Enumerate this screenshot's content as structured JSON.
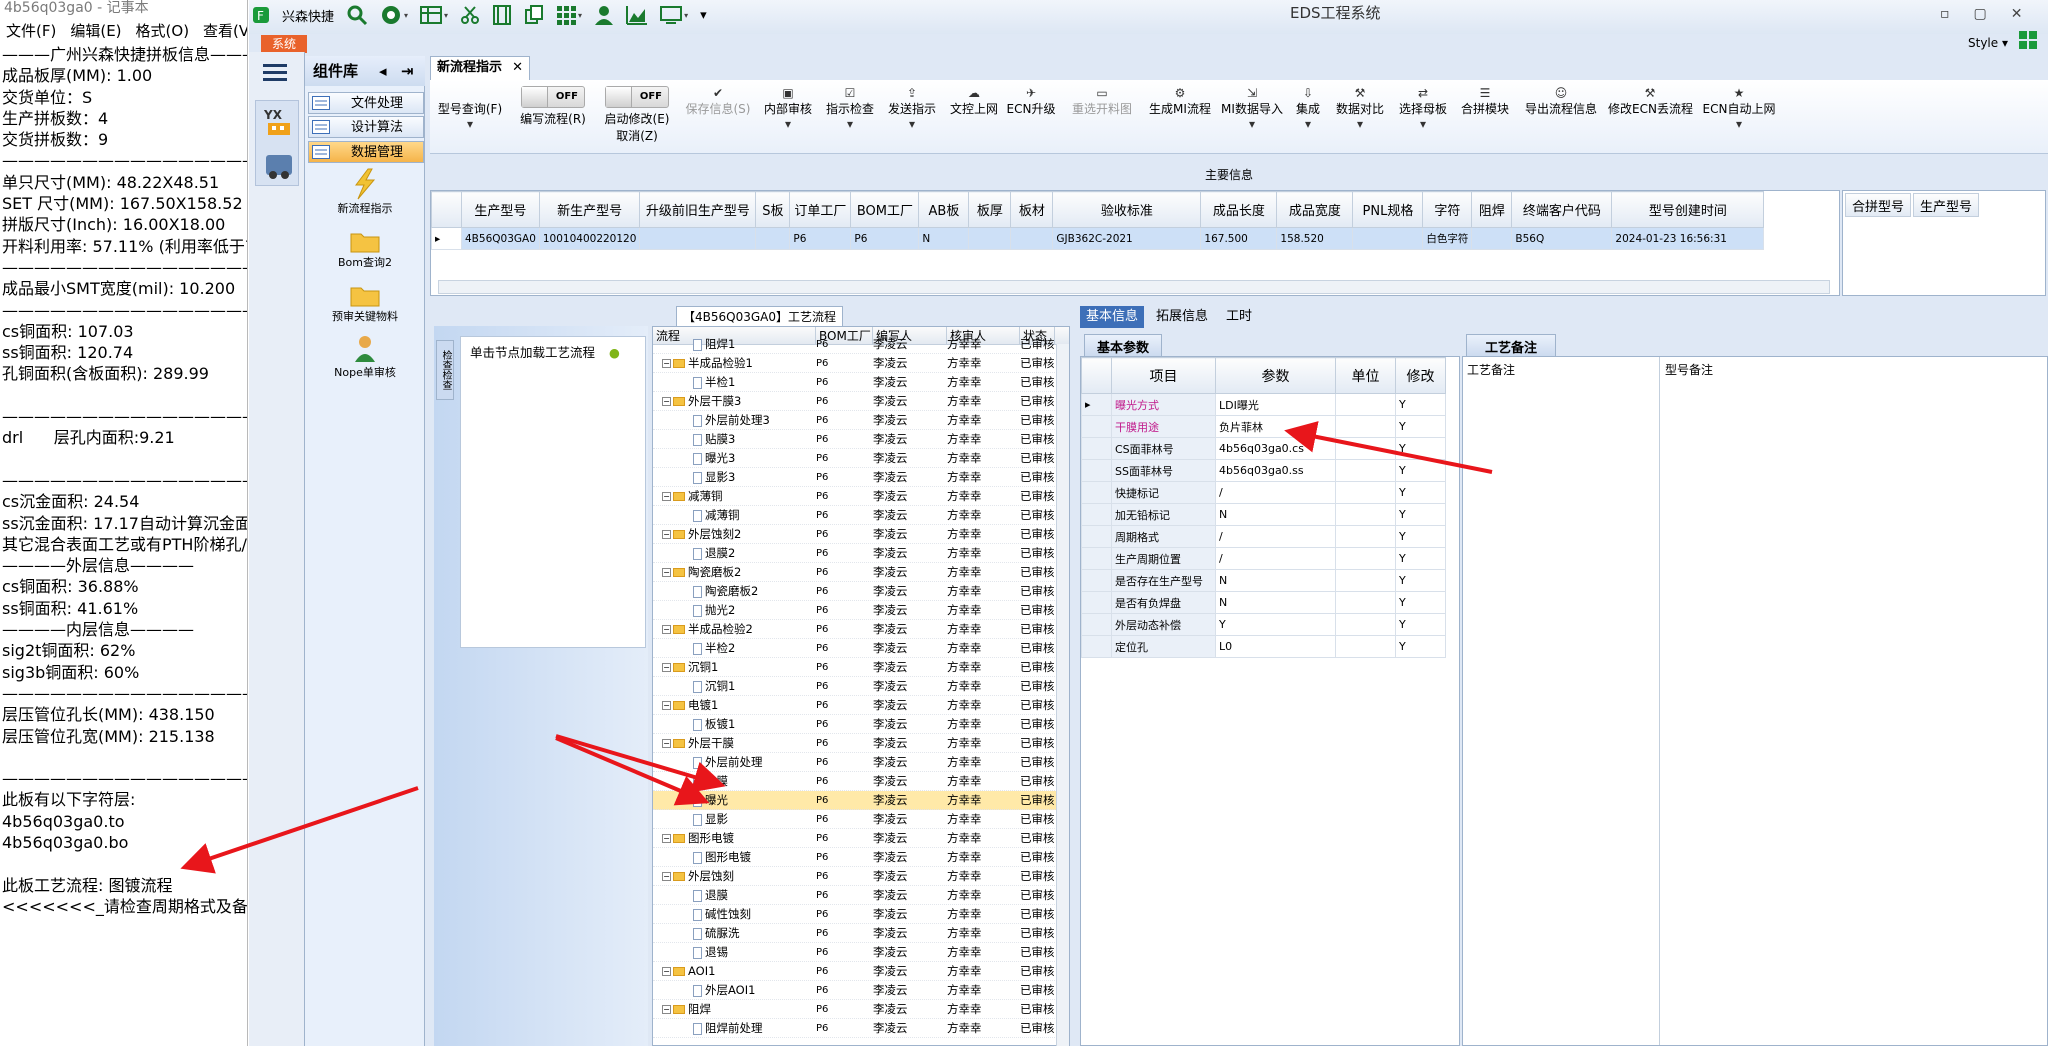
{
  "notepad": {
    "title": "4b56q03ga0 - 记事本",
    "menu": [
      "文件(F)",
      "编辑(E)",
      "格式(O)",
      "查看(V)"
    ],
    "lines": [
      "———广州兴森快捷拼板信息———",
      "成品板厚(MM): 1.00",
      "交货单位：S",
      "生产拼板数：4",
      "交货拼板数：9",
      "—————————————————",
      "单只尺寸(MM): 48.22X48.51",
      "SET 尺寸(MM): 167.50X158.52",
      "拼版尺寸(Inch): 16.00X18.00",
      "开料利用率: 57.11% (利用率低于70",
      "—————————————————",
      "成品最小SMT宽度(mil): 10.200",
      "—————————————————",
      "cs铜面积: 107.03",
      "ss铜面积: 120.74",
      "孔铜面积(含板面积): 289.99",
      "",
      "—————————————————",
      "drl      层孔内面积:9.21",
      "",
      "—————————————————",
      "cs沉金面积: 24.54",
      "ss沉金面积: 17.17自动计算沉金面积",
      "其它混合表面工艺或有PTH阶梯孔/",
      "————外层信息————",
      "cs铜面积: 36.88%",
      "ss铜面积: 41.61%",
      "————内层信息————",
      "sig2t铜面积: 62%",
      "sig3b铜面积: 60%",
      "—————————————————",
      "层压管位孔长(MM): 438.150",
      "层压管位孔宽(MM): 215.138",
      "",
      "—————————————————",
      "此板有以下字符层:",
      "4b56q03ga0.to",
      "4b56q03ga0.bo",
      "",
      "此板工艺流程: 图镀流程",
      "<<<<<<<_请检查周期格式及备注"
    ]
  },
  "app": {
    "title": "EDS工程系统",
    "quick_label": "兴森快捷",
    "system_tab": "系统",
    "style_label": "Style",
    "component_lib": "组件库",
    "nav_buttons": [
      "文件处理",
      "设计算法",
      "数据管理"
    ],
    "tools": [
      "新流程指示",
      "Bom查询2",
      "预审关键物料",
      "Nope单审核"
    ],
    "doc_tab": "新流程指示",
    "ribbon": [
      {
        "label": "型号查询(F)"
      },
      {
        "label": "编写流程(R)",
        "toggle": "OFF"
      },
      {
        "label": "启动修改(E)",
        "sub": "取消(Z)",
        "toggle": "OFF"
      },
      {
        "label": "保存信息(S)",
        "disabled": true
      },
      {
        "label": "内部审核"
      },
      {
        "label": "指示检查"
      },
      {
        "label": "发送指示"
      },
      {
        "label": "文控上网"
      },
      {
        "label": "ECN升级"
      },
      {
        "label": "重选开料图",
        "disabled": true
      },
      {
        "label": "生成MI流程"
      },
      {
        "label": "MI数据导入"
      },
      {
        "label": "集成"
      },
      {
        "label": "数据对比"
      },
      {
        "label": "选择母板"
      },
      {
        "label": "合拼模块"
      },
      {
        "label": "导出流程信息"
      },
      {
        "label": "修改ECN丢流程"
      },
      {
        "label": "ECN自动上网"
      }
    ],
    "main_info_label": "主要信息",
    "grid_headers": [
      "生产型号",
      "新生产型号",
      "升级前旧生产型号",
      "S板",
      "订单工厂",
      "BOM工厂",
      "AB板",
      "板厚",
      "板材",
      "验收标准",
      "成品长度",
      "成品宽度",
      "PNL规格",
      "字符",
      "阻焊",
      "终端客户代码",
      "型号创建时间"
    ],
    "grid_row": [
      "4B56Q03GA0",
      "10010400220120",
      "",
      "",
      "P6",
      "P6",
      "N",
      "",
      "",
      "GJB362C-2021",
      "167.500",
      "158.520",
      "",
      "白色字符",
      "",
      "B56Q",
      "2024-01-23 16:56:31"
    ],
    "merge_headers": [
      "合拼型号",
      "生产型号"
    ],
    "process_title": "【4B56Q03GA0】工艺流程",
    "left_panel_hint": "单击节点加载工艺流程",
    "left_panel_vtab": "检查检查",
    "tree_headers": [
      "流程",
      "BOM工厂",
      "编写人",
      "核审人",
      "状态"
    ],
    "tree_rows": [
      {
        "name": "阻焊1",
        "lvl": 2,
        "f": "P6",
        "w": "李凌云",
        "r": "方幸幸",
        "s": "已审核"
      },
      {
        "name": "半成品检验1",
        "lvl": 1,
        "f": "P6",
        "w": "李凌云",
        "r": "方幸幸",
        "s": "已审核"
      },
      {
        "name": "半检1",
        "lvl": 2,
        "f": "P6",
        "w": "李凌云",
        "r": "方幸幸",
        "s": "已审核"
      },
      {
        "name": "外层干膜3",
        "lvl": 1,
        "f": "P6",
        "w": "李凌云",
        "r": "方幸幸",
        "s": "已审核"
      },
      {
        "name": "外层前处理3",
        "lvl": 2,
        "f": "P6",
        "w": "李凌云",
        "r": "方幸幸",
        "s": "已审核"
      },
      {
        "name": "贴膜3",
        "lvl": 2,
        "f": "P6",
        "w": "李凌云",
        "r": "方幸幸",
        "s": "已审核"
      },
      {
        "name": "曝光3",
        "lvl": 2,
        "f": "P6",
        "w": "李凌云",
        "r": "方幸幸",
        "s": "已审核"
      },
      {
        "name": "显影3",
        "lvl": 2,
        "f": "P6",
        "w": "李凌云",
        "r": "方幸幸",
        "s": "已审核"
      },
      {
        "name": "减薄铜",
        "lvl": 1,
        "f": "P6",
        "w": "李凌云",
        "r": "方幸幸",
        "s": "已审核"
      },
      {
        "name": "减薄铜",
        "lvl": 2,
        "f": "P6",
        "w": "李凌云",
        "r": "方幸幸",
        "s": "已审核"
      },
      {
        "name": "外层蚀刻2",
        "lvl": 1,
        "f": "P6",
        "w": "李凌云",
        "r": "方幸幸",
        "s": "已审核"
      },
      {
        "name": "退膜2",
        "lvl": 2,
        "f": "P6",
        "w": "李凌云",
        "r": "方幸幸",
        "s": "已审核"
      },
      {
        "name": "陶瓷磨板2",
        "lvl": 1,
        "f": "P6",
        "w": "李凌云",
        "r": "方幸幸",
        "s": "已审核"
      },
      {
        "name": "陶瓷磨板2",
        "lvl": 2,
        "f": "P6",
        "w": "李凌云",
        "r": "方幸幸",
        "s": "已审核"
      },
      {
        "name": "抛光2",
        "lvl": 2,
        "f": "P6",
        "w": "李凌云",
        "r": "方幸幸",
        "s": "已审核"
      },
      {
        "name": "半成品检验2",
        "lvl": 1,
        "f": "P6",
        "w": "李凌云",
        "r": "方幸幸",
        "s": "已审核"
      },
      {
        "name": "半检2",
        "lvl": 2,
        "f": "P6",
        "w": "李凌云",
        "r": "方幸幸",
        "s": "已审核"
      },
      {
        "name": "沉铜1",
        "lvl": 1,
        "f": "P6",
        "w": "李凌云",
        "r": "方幸幸",
        "s": "已审核"
      },
      {
        "name": "沉铜1",
        "lvl": 2,
        "f": "P6",
        "w": "李凌云",
        "r": "方幸幸",
        "s": "已审核"
      },
      {
        "name": "电镀1",
        "lvl": 1,
        "f": "P6",
        "w": "李凌云",
        "r": "方幸幸",
        "s": "已审核"
      },
      {
        "name": "板镀1",
        "lvl": 2,
        "f": "P6",
        "w": "李凌云",
        "r": "方幸幸",
        "s": "已审核"
      },
      {
        "name": "外层干膜",
        "lvl": 1,
        "f": "P6",
        "w": "李凌云",
        "r": "方幸幸",
        "s": "已审核"
      },
      {
        "name": "外层前处理",
        "lvl": 2,
        "f": "P6",
        "w": "李凌云",
        "r": "方幸幸",
        "s": "已审核"
      },
      {
        "name": "贴膜",
        "lvl": 2,
        "f": "P6",
        "w": "李凌云",
        "r": "方幸幸",
        "s": "已审核"
      },
      {
        "name": "曝光",
        "lvl": 2,
        "f": "P6",
        "w": "李凌云",
        "r": "方幸幸",
        "s": "已审核",
        "sel": true
      },
      {
        "name": "显影",
        "lvl": 2,
        "f": "P6",
        "w": "李凌云",
        "r": "方幸幸",
        "s": "已审核"
      },
      {
        "name": "图形电镀",
        "lvl": 1,
        "f": "P6",
        "w": "李凌云",
        "r": "方幸幸",
        "s": "已审核"
      },
      {
        "name": "图形电镀",
        "lvl": 2,
        "f": "P6",
        "w": "李凌云",
        "r": "方幸幸",
        "s": "已审核"
      },
      {
        "name": "外层蚀刻",
        "lvl": 1,
        "f": "P6",
        "w": "李凌云",
        "r": "方幸幸",
        "s": "已审核"
      },
      {
        "name": "退膜",
        "lvl": 2,
        "f": "P6",
        "w": "李凌云",
        "r": "方幸幸",
        "s": "已审核"
      },
      {
        "name": "碱性蚀刻",
        "lvl": 2,
        "f": "P6",
        "w": "李凌云",
        "r": "方幸幸",
        "s": "已审核"
      },
      {
        "name": "硫脲洗",
        "lvl": 2,
        "f": "P6",
        "w": "李凌云",
        "r": "方幸幸",
        "s": "已审核"
      },
      {
        "name": "退锡",
        "lvl": 2,
        "f": "P6",
        "w": "李凌云",
        "r": "方幸幸",
        "s": "已审核"
      },
      {
        "name": "AOI1",
        "lvl": 1,
        "f": "P6",
        "w": "李凌云",
        "r": "方幸幸",
        "s": "已审核"
      },
      {
        "name": "外层AOI1",
        "lvl": 2,
        "f": "P6",
        "w": "李凌云",
        "r": "方幸幸",
        "s": "已审核"
      },
      {
        "name": "阻焊",
        "lvl": 1,
        "f": "P6",
        "w": "李凌云",
        "r": "方幸幸",
        "s": "已审核"
      },
      {
        "name": "阻焊前处理",
        "lvl": 2,
        "f": "P6",
        "w": "李凌云",
        "r": "方幸幸",
        "s": "已审核"
      }
    ],
    "detail_tabs": [
      "基本信息",
      "拓展信息",
      "工时"
    ],
    "basic_params_title": "基本参数",
    "param_headers": [
      "项目",
      "参数",
      "单位",
      "修改"
    ],
    "params": [
      {
        "k": "曝光方式",
        "v": "LDI曝光",
        "m": "Y",
        "hl": true
      },
      {
        "k": "干膜用途",
        "v": "负片菲林",
        "m": "Y",
        "hl": true
      },
      {
        "k": "CS面菲林号",
        "v": "4b56q03ga0.cs",
        "m": "Y"
      },
      {
        "k": "SS面菲林号",
        "v": "4b56q03ga0.ss",
        "m": "Y"
      },
      {
        "k": "快捷标记",
        "v": "/",
        "m": "Y"
      },
      {
        "k": "加无铅标记",
        "v": "N",
        "m": "Y"
      },
      {
        "k": "周期格式",
        "v": "/",
        "m": "Y"
      },
      {
        "k": "生产周期位置",
        "v": "/",
        "m": "Y"
      },
      {
        "k": "是否存在生产型号",
        "v": "N",
        "m": "Y"
      },
      {
        "k": "是否有负焊盘",
        "v": "N",
        "m": "Y"
      },
      {
        "k": "外层动态补偿",
        "v": "Y",
        "m": "Y"
      },
      {
        "k": "定位孔",
        "v": "L0",
        "m": "Y"
      }
    ],
    "notes_title": "工艺备注",
    "notes_cols": [
      "工艺备注",
      "型号备注"
    ]
  },
  "colors": {
    "accent": "#3d6fb8",
    "arrow": "#e8161b",
    "system_tab": "#e9622b",
    "highlight": "#ffe9a8"
  }
}
